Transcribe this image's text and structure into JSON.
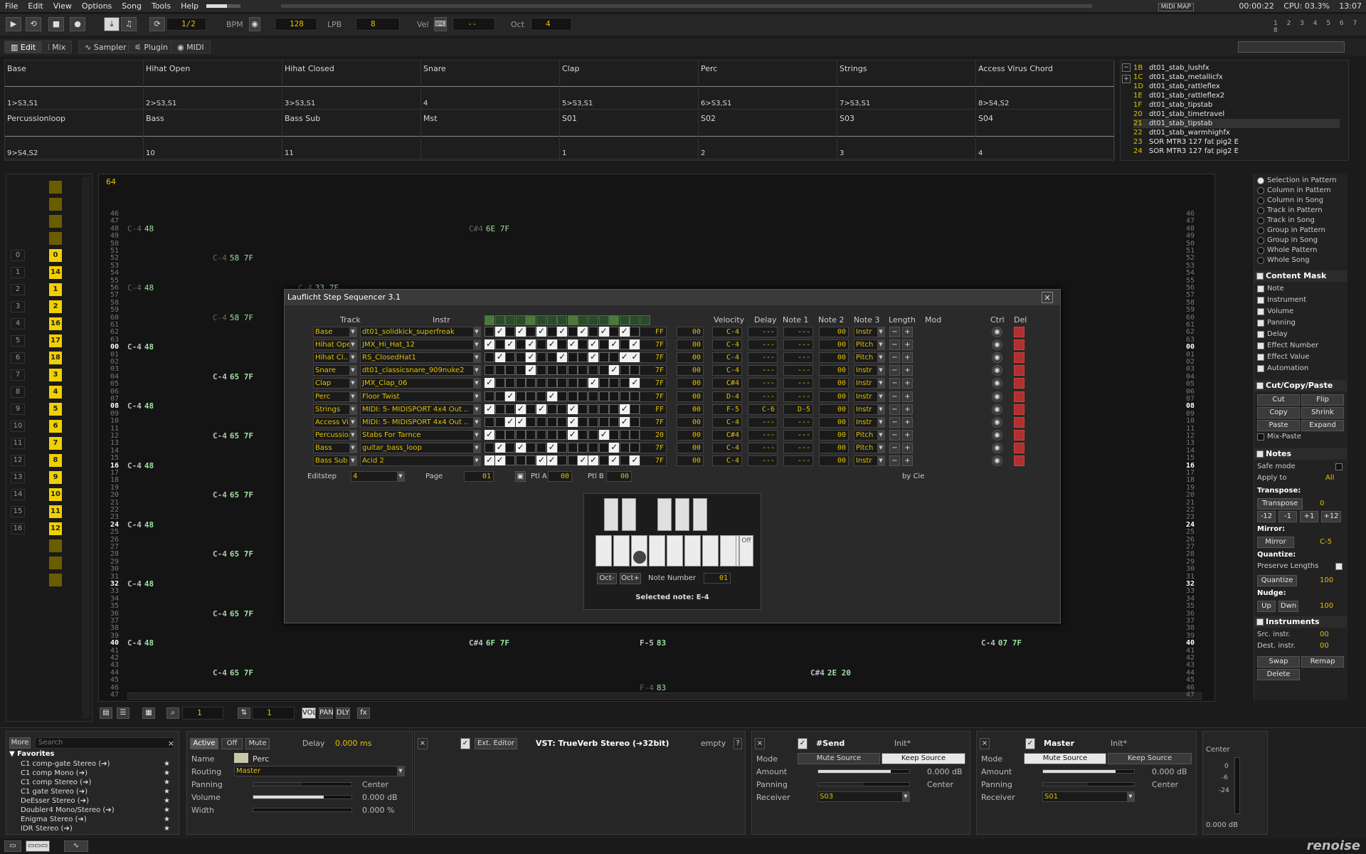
{
  "menu": {
    "items": [
      "File",
      "Edit",
      "View",
      "Options",
      "Song",
      "Tools",
      "Help"
    ],
    "midimap": "MIDI MAP",
    "time": "00:00:22",
    "cpu": "CPU: 03.3%",
    "clock": "13:07"
  },
  "transport": {
    "edit_step": "1/2",
    "bpm_label": "BPM",
    "bpm": "128",
    "lpb_label": "LPB",
    "lpb": "8",
    "vel_label": "Vel",
    "vel": "--",
    "oct_label": "Oct",
    "oct": "4"
  },
  "tabs": {
    "edit": "Edit",
    "mix": "Mix",
    "sampler": "Sampler",
    "plugin": "Plugin",
    "midi": "MIDI"
  },
  "sequencer_top": {
    "row1": [
      {
        "name": "Base",
        "seq": "1>S3,S1"
      },
      {
        "name": "Hihat Open",
        "seq": "2>S3,S1"
      },
      {
        "name": "Hihat Closed",
        "seq": "3>S3,S1"
      },
      {
        "name": "Snare",
        "seq": "4"
      },
      {
        "name": "Clap",
        "seq": "5>S3,S1"
      },
      {
        "name": "Perc",
        "seq": "6>S3,S1"
      },
      {
        "name": "Strings",
        "seq": "7>S3,S1"
      },
      {
        "name": "Access Virus Chord",
        "seq": "8>S4,S2"
      }
    ],
    "row2": [
      {
        "name": "Percussionloop",
        "seq": "9>S4,S2"
      },
      {
        "name": "Bass",
        "seq": "10"
      },
      {
        "name": "Bass Sub",
        "seq": "11"
      },
      {
        "name": "Mst",
        "seq": ""
      },
      {
        "name": "S01",
        "seq": "1"
      },
      {
        "name": "S02",
        "seq": "2"
      },
      {
        "name": "S03",
        "seq": "3"
      },
      {
        "name": "S04",
        "seq": "4"
      }
    ]
  },
  "instruments": [
    {
      "num": "1B",
      "name": "dt01_stab_lushfx"
    },
    {
      "num": "1C",
      "name": "dt01_stab_metallicfx"
    },
    {
      "num": "1D",
      "name": "dt01_stab_rattleflex"
    },
    {
      "num": "1E",
      "name": "dt01_stab_rattleflex2"
    },
    {
      "num": "1F",
      "name": "dt01_stab_tipstab"
    },
    {
      "num": "20",
      "name": "dt01_stab_timetravel"
    },
    {
      "num": "21",
      "name": "dt01_stab_tipstab"
    },
    {
      "num": "22",
      "name": "dt01_stab_warmhighfx"
    },
    {
      "num": "23",
      "name": "SOR MTR3 127 fat pig2 E"
    },
    {
      "num": "24",
      "name": "SOR MTR3 127 fat pig2 E"
    }
  ],
  "pattern_seq": {
    "current": "64",
    "numbers": [
      "0",
      "1",
      "2",
      "3",
      "4",
      "5",
      "6",
      "7",
      "8",
      "9",
      "10",
      "11",
      "12",
      "13",
      "14",
      "15",
      "16"
    ],
    "slots": [
      "0",
      "14",
      "1",
      "2",
      "16",
      "17",
      "18",
      "3",
      "4",
      "5",
      "6",
      "7",
      "8",
      "9",
      "10",
      "11",
      "12"
    ]
  },
  "tracks": [
    {
      "name": "Base",
      "color": "#6a7a8a"
    },
    {
      "name": "Hihat Open",
      "color": "#8a7a9a"
    },
    {
      "name": "Hihat Closed",
      "color": "#8a7a9a"
    },
    {
      "name": "Snare",
      "color": "#8aa0c0"
    },
    {
      "name": "Clap",
      "color": "#a0b080"
    },
    {
      "name": "Perc",
      "color": "#c0c0a0"
    },
    {
      "name": "Strings",
      "color": "#8a8aa0"
    },
    {
      "name": "Access Virus Chord",
      "color": "#7a8a9a"
    },
    {
      "name": "Percussionloop",
      "color": "#8a7a9a"
    },
    {
      "name": "Bass",
      "color": "#80c080"
    },
    {
      "name": "Bass Sub",
      "color": "#80c0a0"
    },
    {
      "name": "Mst",
      "color": "#e0e0e0"
    },
    {
      "name": "S01",
      "color": "#c06080"
    },
    {
      "name": "S02",
      "color": "#60a060"
    },
    {
      "name": "S03",
      "color": "#60a0a0"
    },
    {
      "name": "S04",
      "color": "#60a0a0"
    }
  ],
  "track_play": "PLAY",
  "grid_rows": [
    "46",
    "47",
    "48",
    "49",
    "50",
    "51",
    "52",
    "53",
    "54",
    "55",
    "56",
    "57",
    "58",
    "59",
    "60",
    "61",
    "62",
    "63",
    "00",
    "01",
    "02",
    "03",
    "04",
    "05",
    "06",
    "07",
    "08",
    "09",
    "10",
    "11",
    "12",
    "13",
    "14",
    "15",
    "16",
    "17",
    "18",
    "19",
    "20",
    "21",
    "22",
    "23",
    "24",
    "25",
    "26",
    "27",
    "28",
    "29",
    "30",
    "31",
    "32",
    "33",
    "34",
    "35",
    "36",
    "37",
    "38",
    "39",
    "40",
    "41",
    "42",
    "43",
    "44",
    "45",
    "46",
    "47"
  ],
  "grid_notes": [
    {
      "row": 2,
      "col": 0,
      "text": "C-4",
      "val": "48",
      "faint": true
    },
    {
      "row": 2,
      "col": 4,
      "text": "C#4",
      "val": "6E 7F",
      "faint": true
    },
    {
      "row": 6,
      "col": 1,
      "text": "C-4",
      "val": "58 7F",
      "faint": true
    },
    {
      "row": 10,
      "col": 0,
      "text": "C-4",
      "val": "48",
      "faint": true
    },
    {
      "row": 10,
      "col": 2,
      "text": "C-4",
      "val": "33 7F",
      "faint": true
    },
    {
      "row": 14,
      "col": 1,
      "text": "C-4",
      "val": "58 7F",
      "faint": true
    },
    {
      "row": 18,
      "col": 0,
      "text": "C-4",
      "val": "48",
      "faint": false
    },
    {
      "row": 22,
      "col": 1,
      "text": "C-4",
      "val": "65 7F",
      "faint": false
    },
    {
      "row": 26,
      "col": 0,
      "text": "C-4",
      "val": "48",
      "faint": false
    },
    {
      "row": 30,
      "col": 1,
      "text": "C-4",
      "val": "65 7F",
      "faint": false
    },
    {
      "row": 34,
      "col": 0,
      "text": "C-4",
      "val": "48",
      "faint": false
    },
    {
      "row": 38,
      "col": 1,
      "text": "C-4",
      "val": "65 7F",
      "faint": false
    },
    {
      "row": 42,
      "col": 0,
      "text": "C-4",
      "val": "48",
      "faint": false
    },
    {
      "row": 46,
      "col": 1,
      "text": "C-4",
      "val": "65 7F",
      "faint": false
    },
    {
      "row": 50,
      "col": 0,
      "text": "C-4",
      "val": "48",
      "faint": false
    },
    {
      "row": 54,
      "col": 1,
      "text": "C-4",
      "val": "65 7F",
      "faint": false
    },
    {
      "row": 58,
      "col": 0,
      "text": "C-4",
      "val": "48",
      "faint": false
    },
    {
      "row": 58,
      "col": 4,
      "text": "C#4",
      "val": "6F 7F",
      "faint": false
    },
    {
      "row": 58,
      "col": 6,
      "text": "F-5",
      "val": "83",
      "faint": false
    },
    {
      "row": 58,
      "col": 10,
      "text": "C-4",
      "val": "07 7F",
      "faint": false
    },
    {
      "row": 62,
      "col": 1,
      "text": "C-4",
      "val": "65 7F",
      "faint": false
    },
    {
      "row": 62,
      "col": 8,
      "text": "C#4",
      "val": "2E 20",
      "faint": false
    },
    {
      "row": 64,
      "col": 6,
      "text": "F-4",
      "val": "83",
      "faint": true
    }
  ],
  "dialog": {
    "title": "Lauflicht Step Sequencer 3.1",
    "col_track": "Track",
    "col_instr": "Instr",
    "col_velocity": "Velocity",
    "col_delay": "Delay",
    "col_note1": "Note 1",
    "col_note2": "Note 2",
    "col_note3": "Note 3",
    "col_length": "Length",
    "col_mod": "Mod",
    "col_ctrl": "Ctrl",
    "col_del": "Del",
    "rows": [
      {
        "track": "Base",
        "instr": "dt01_solidkick_superfreak",
        "steps": [
          0,
          1,
          0,
          1,
          0,
          1,
          0,
          1,
          0,
          1,
          0,
          1,
          0,
          1,
          0,
          1
        ],
        "vel": "FF",
        "delay": "00",
        "n1": "C-4",
        "n2": "---",
        "n3": "---",
        "len": "00",
        "mod": "Instr"
      },
      {
        "track": "Hihat Open",
        "instr": "JMX_Hi_Hat_12",
        "steps": [
          1,
          0,
          1,
          0,
          1,
          0,
          1,
          0,
          1,
          0,
          1,
          0,
          1,
          0,
          1,
          0
        ],
        "vel": "7F",
        "delay": "00",
        "n1": "C-4",
        "n2": "---",
        "n3": "---",
        "len": "00",
        "mod": "Pitch"
      },
      {
        "track": "Hihat Cl..",
        "instr": "RS_ClosedHat1",
        "steps": [
          0,
          1,
          0,
          0,
          1,
          0,
          0,
          1,
          0,
          0,
          1,
          0,
          0,
          1,
          1,
          1
        ],
        "vel": "7F",
        "delay": "00",
        "n1": "C-4",
        "n2": "---",
        "n3": "---",
        "len": "00",
        "mod": "Pitch"
      },
      {
        "track": "Snare",
        "instr": "dt01_classicsnare_909nuke2",
        "steps": [
          0,
          0,
          0,
          0,
          1,
          0,
          0,
          0,
          0,
          0,
          0,
          0,
          1,
          0,
          0,
          0
        ],
        "vel": "7F",
        "delay": "00",
        "n1": "C-4",
        "n2": "---",
        "n3": "---",
        "len": "00",
        "mod": "Instr"
      },
      {
        "track": "Clap",
        "instr": "JMX_Clap_06",
        "steps": [
          1,
          0,
          0,
          0,
          0,
          0,
          0,
          0,
          0,
          0,
          1,
          0,
          0,
          0,
          1,
          0
        ],
        "vel": "7F",
        "delay": "00",
        "n1": "C#4",
        "n2": "---",
        "n3": "---",
        "len": "00",
        "mod": "Instr"
      },
      {
        "track": "Perc",
        "instr": "Floor Twist",
        "steps": [
          0,
          0,
          1,
          0,
          0,
          0,
          1,
          0,
          0,
          0,
          0,
          0,
          0,
          0,
          0,
          1
        ],
        "vel": "7F",
        "delay": "00",
        "n1": "D-4",
        "n2": "---",
        "n3": "---",
        "len": "00",
        "mod": "Instr"
      },
      {
        "track": "Strings",
        "instr": "MIDI: 5- MIDISPORT 4x4 Out ..",
        "steps": [
          1,
          0,
          0,
          1,
          0,
          1,
          0,
          0,
          1,
          0,
          0,
          0,
          0,
          1,
          0,
          0
        ],
        "vel": "FF",
        "delay": "00",
        "n1": "F-5",
        "n2": "C-6",
        "n3": "D-5",
        "len": "00",
        "mod": "Instr"
      },
      {
        "track": "Access Vi..",
        "instr": "MIDI: 5- MIDISPORT 4x4 Out ..",
        "steps": [
          0,
          0,
          1,
          1,
          0,
          0,
          0,
          0,
          1,
          0,
          0,
          0,
          0,
          1,
          0,
          0
        ],
        "vel": "7F",
        "delay": "00",
        "n1": "C-4",
        "n2": "---",
        "n3": "---",
        "len": "00",
        "mod": "Instr"
      },
      {
        "track": "Percussio..",
        "instr": "Stabs For Tarnce",
        "steps": [
          1,
          0,
          0,
          0,
          0,
          0,
          0,
          0,
          1,
          0,
          0,
          1,
          0,
          0,
          0,
          0
        ],
        "vel": "20",
        "delay": "00",
        "n1": "C#4",
        "n2": "---",
        "n3": "---",
        "len": "00",
        "mod": "Pitch"
      },
      {
        "track": "Bass",
        "instr": "guitar_bass_loop",
        "steps": [
          0,
          1,
          0,
          1,
          0,
          0,
          1,
          0,
          0,
          0,
          0,
          0,
          1,
          0,
          0,
          1
        ],
        "vel": "7F",
        "delay": "00",
        "n1": "C-4",
        "n2": "---",
        "n3": "---",
        "len": "00",
        "mod": "Pitch"
      },
      {
        "track": "Bass Sub",
        "instr": "Acid 2",
        "steps": [
          1,
          1,
          0,
          0,
          0,
          1,
          1,
          0,
          0,
          1,
          1,
          0,
          1,
          0,
          1,
          1
        ],
        "vel": "7F",
        "delay": "00",
        "n1": "C-4",
        "n2": "---",
        "n3": "---",
        "len": "00",
        "mod": "Instr"
      }
    ],
    "editstep_label": "Editstep",
    "editstep": "4",
    "page_label": "Page",
    "page": "01",
    "ptla_label": "Ptl A",
    "ptla": "00",
    "ptlb_label": "Ptl B",
    "ptlb": "00",
    "by": "by Cie",
    "oct_minus": "Oct-",
    "oct_plus": "Oct+",
    "note_number_label": "Note Number",
    "note_number": "01",
    "selected_note": "Selected note: E-4",
    "off_label": "Off"
  },
  "right": {
    "scope": [
      "Selection in Pattern",
      "Column in Pattern",
      "Column in Song",
      "Track in Pattern",
      "Track in Song",
      "Group in Pattern",
      "Group in Song",
      "Whole Pattern",
      "Whole Song"
    ],
    "mask_title": "Content Mask",
    "mask": [
      "Note",
      "Instrument",
      "Volume",
      "Panning",
      "Delay",
      "Effect Number",
      "Effect Value",
      "Automation"
    ],
    "ccp_title": "Cut/Copy/Paste",
    "cut": "Cut",
    "flip": "Flip",
    "copy": "Copy",
    "shrink": "Shrink",
    "paste": "Paste",
    "expand": "Expand",
    "mixpaste": "Mix-Paste",
    "notes_title": "Notes",
    "safe": "Safe mode",
    "apply_label": "Apply to",
    "apply": "All",
    "transpose_title": "Transpose:",
    "transpose_btn": "Transpose",
    "transpose_val": "0",
    "m12": "-12",
    "m1": "-1",
    "p1": "+1",
    "p12": "+12",
    "mirror_title": "Mirror:",
    "mirror_btn": "Mirror",
    "mirror_val": "C-5",
    "quant_title": "Quantize:",
    "preserve": "Preserve Lengths",
    "quant_btn": "Quantize",
    "quant_val": "100",
    "nudge_title": "Nudge:",
    "up": "Up",
    "dwn": "Dwn",
    "nudge_val": "100",
    "inst_title": "Instruments",
    "src_label": "Src. instr.",
    "src": "00",
    "dest_label": "Dest. instr.",
    "dest": "00",
    "swap": "Swap",
    "remap": "Remap",
    "delete": "Delete"
  },
  "grid_toolbar": {
    "a": "1",
    "b": "1"
  },
  "bottom": {
    "more": "More",
    "search": "Search",
    "fav_title": "Favorites",
    "favorites": [
      "C1 comp-gate Stereo (➔)",
      "C1 comp Mono (➔)",
      "C1 comp Stereo (➔)",
      "C1 gate Stereo (➔)",
      "DeEsser Stereo (➔)",
      "Doubler4 Mono/Stereo (➔)",
      "Enigma Stereo (➔)",
      "IDR Stereo (➔)"
    ],
    "active": "Active",
    "off": "Off",
    "mute": "Mute",
    "delay_label": "Delay",
    "delay": "0.000 ms",
    "name_label": "Name",
    "name": "Perc",
    "routing_label": "Routing",
    "routing": "Master",
    "panning_label": "Panning",
    "panning": "Center",
    "volume_label": "Volume",
    "volume": "0.000 dB",
    "width_label": "Width",
    "width": "0.000 %",
    "ext_editor": "Ext. Editor",
    "vst": "VST: TrueVerb Stereo (➔32bit)",
    "empty": "empty",
    "send_title": "#Send",
    "init": "Init*",
    "mode_label": "Mode",
    "mute_source": "Mute Source",
    "keep_source": "Keep Source",
    "amount_label": "Amount",
    "amount": "0.000 dB",
    "pan_label": "Panning",
    "pan": "Center",
    "receiver_label": "Receiver",
    "receiver": "S03",
    "master_title": "Master",
    "m_amount": "0.000 dB",
    "m_pan": "Center",
    "m_receiver": "S01",
    "meter_center": "Center",
    "meter_0": "0",
    "meter_6": "-6",
    "meter_24": "-24",
    "meter_db": "0.000 dB"
  },
  "brand": "renoise"
}
